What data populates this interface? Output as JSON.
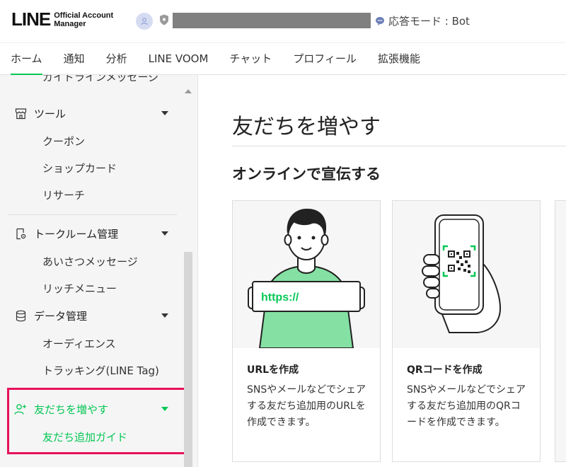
{
  "header": {
    "logo_line": "LINE",
    "logo_sub1": "Official Account",
    "logo_sub2": "Manager",
    "mode_label": "応答モード : Bot"
  },
  "tabs": [
    {
      "label": "ホーム",
      "active": true
    },
    {
      "label": "通知"
    },
    {
      "label": "分析"
    },
    {
      "label": "LINE VOOM"
    },
    {
      "label": "チャット"
    },
    {
      "label": "プロフィール"
    },
    {
      "label": "拡張機能"
    }
  ],
  "sidebar": {
    "cut_item": "ガイドラインメッセージ",
    "tools": {
      "label": "ツール",
      "items": [
        "クーポン",
        "ショップカード",
        "リサーチ"
      ]
    },
    "talkroom": {
      "label": "トークルーム管理",
      "items": [
        "あいさつメッセージ",
        "リッチメニュー"
      ]
    },
    "data": {
      "label": "データ管理",
      "items": [
        "オーディエンス",
        "トラッキング(LINE Tag)"
      ]
    },
    "friends": {
      "label": "友だちを増やす",
      "items": [
        "友だち追加ガイド"
      ]
    }
  },
  "main": {
    "page_title": "友だちを増やす",
    "section_title": "オンラインで宣伝する",
    "cards": [
      {
        "title": "URLを作成",
        "desc": "SNSやメールなどでシェアする友だち追加用のURLを作成できます。",
        "banner_text": "https://"
      },
      {
        "title": "QRコードを作成",
        "desc": "SNSやメールなどでシェアする友だち追加用のQRコードを作成できます。"
      }
    ]
  },
  "colors": {
    "accent": "#06c755",
    "highlight": "#e8105c"
  }
}
